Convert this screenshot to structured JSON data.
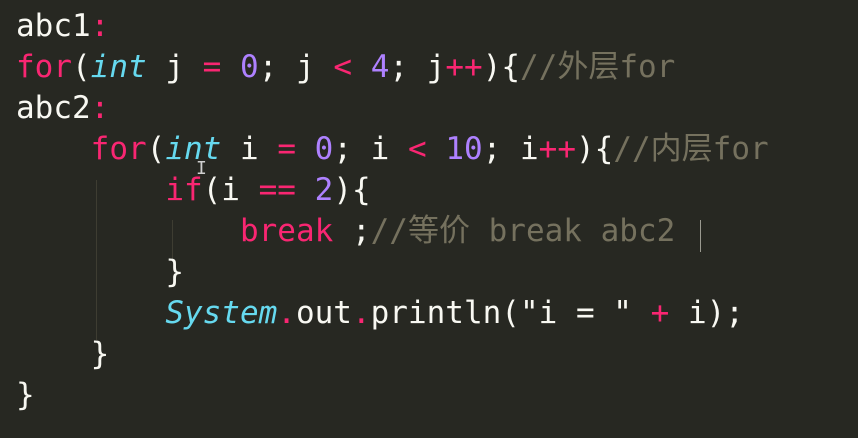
{
  "lines": [
    {
      "tokens": [
        {
          "t": "abc1",
          "c": "lbl"
        },
        {
          "t": ":",
          "c": "op"
        }
      ]
    },
    {
      "tokens": [
        {
          "t": "for",
          "c": "kw"
        },
        {
          "t": "(",
          "c": "pl"
        },
        {
          "t": "int",
          "c": "type"
        },
        {
          "t": " j ",
          "c": "pl"
        },
        {
          "t": "=",
          "c": "op"
        },
        {
          "t": " ",
          "c": "pl"
        },
        {
          "t": "0",
          "c": "num"
        },
        {
          "t": "; j ",
          "c": "pl"
        },
        {
          "t": "<",
          "c": "op"
        },
        {
          "t": " ",
          "c": "pl"
        },
        {
          "t": "4",
          "c": "num"
        },
        {
          "t": "; j",
          "c": "pl"
        },
        {
          "t": "++",
          "c": "op"
        },
        {
          "t": "){",
          "c": "pl"
        },
        {
          "t": "//外层for",
          "c": "cmt"
        }
      ]
    },
    {
      "tokens": [
        {
          "t": "abc2",
          "c": "lbl"
        },
        {
          "t": ":",
          "c": "op"
        }
      ]
    },
    {
      "tokens": [
        {
          "t": "    ",
          "c": "pl"
        },
        {
          "t": "for",
          "c": "kw"
        },
        {
          "t": "(",
          "c": "pl"
        },
        {
          "t": "int",
          "c": "type"
        },
        {
          "t": " i ",
          "c": "pl"
        },
        {
          "t": "=",
          "c": "op"
        },
        {
          "t": " ",
          "c": "pl"
        },
        {
          "t": "0",
          "c": "num"
        },
        {
          "t": "; i ",
          "c": "pl"
        },
        {
          "t": "<",
          "c": "op"
        },
        {
          "t": " ",
          "c": "pl"
        },
        {
          "t": "10",
          "c": "num"
        },
        {
          "t": "; i",
          "c": "pl"
        },
        {
          "t": "++",
          "c": "op"
        },
        {
          "t": "){",
          "c": "pl"
        },
        {
          "t": "//内层for",
          "c": "cmt"
        }
      ]
    },
    {
      "tokens": [
        {
          "t": "        ",
          "c": "pl"
        },
        {
          "t": "if",
          "c": "kw"
        },
        {
          "t": "(i ",
          "c": "pl"
        },
        {
          "t": "==",
          "c": "op"
        },
        {
          "t": " ",
          "c": "pl"
        },
        {
          "t": "2",
          "c": "num"
        },
        {
          "t": "){",
          "c": "pl"
        }
      ]
    },
    {
      "tokens": [
        {
          "t": "            ",
          "c": "pl"
        },
        {
          "t": "break",
          "c": "kw"
        },
        {
          "t": " ;",
          "c": "pl"
        },
        {
          "t": "//等价 break abc2",
          "c": "cmt"
        }
      ]
    },
    {
      "tokens": [
        {
          "t": "        ",
          "c": "pl"
        },
        {
          "t": "}",
          "c": "pl"
        }
      ]
    },
    {
      "tokens": [
        {
          "t": "        ",
          "c": "pl"
        },
        {
          "t": "System",
          "c": "type"
        },
        {
          "t": ".",
          "c": "op"
        },
        {
          "t": "out",
          "c": "pl"
        },
        {
          "t": ".",
          "c": "op"
        },
        {
          "t": "println(\"i = \" ",
          "c": "pl"
        },
        {
          "t": "+",
          "c": "op"
        },
        {
          "t": " i);",
          "c": "pl"
        }
      ]
    },
    {
      "tokens": [
        {
          "t": "    ",
          "c": "pl"
        },
        {
          "t": "}",
          "c": "pl"
        }
      ]
    },
    {
      "tokens": [
        {
          "t": "}",
          "c": "pl"
        }
      ]
    }
  ],
  "theme": {
    "background": "#272822",
    "keyword": "#f92672",
    "type": "#66d9ef",
    "number": "#ae81ff",
    "comment": "#75715e",
    "plain": "#f8f8f2"
  }
}
